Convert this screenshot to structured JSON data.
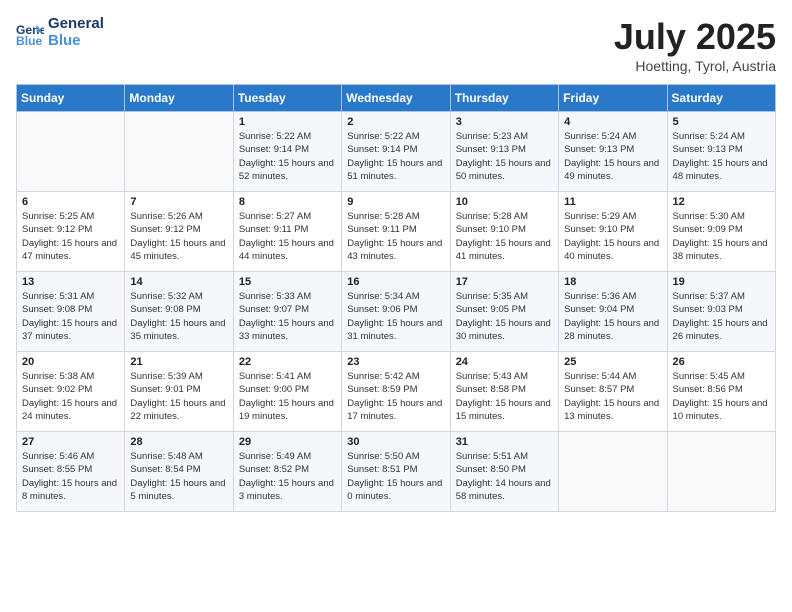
{
  "header": {
    "logo_line1": "General",
    "logo_line2": "Blue",
    "title": "July 2025",
    "subtitle": "Hoetting, Tyrol, Austria"
  },
  "weekdays": [
    "Sunday",
    "Monday",
    "Tuesday",
    "Wednesday",
    "Thursday",
    "Friday",
    "Saturday"
  ],
  "weeks": [
    [
      {
        "day": "",
        "sunrise": "",
        "sunset": "",
        "daylight": ""
      },
      {
        "day": "",
        "sunrise": "",
        "sunset": "",
        "daylight": ""
      },
      {
        "day": "1",
        "sunrise": "Sunrise: 5:22 AM",
        "sunset": "Sunset: 9:14 PM",
        "daylight": "Daylight: 15 hours and 52 minutes."
      },
      {
        "day": "2",
        "sunrise": "Sunrise: 5:22 AM",
        "sunset": "Sunset: 9:14 PM",
        "daylight": "Daylight: 15 hours and 51 minutes."
      },
      {
        "day": "3",
        "sunrise": "Sunrise: 5:23 AM",
        "sunset": "Sunset: 9:13 PM",
        "daylight": "Daylight: 15 hours and 50 minutes."
      },
      {
        "day": "4",
        "sunrise": "Sunrise: 5:24 AM",
        "sunset": "Sunset: 9:13 PM",
        "daylight": "Daylight: 15 hours and 49 minutes."
      },
      {
        "day": "5",
        "sunrise": "Sunrise: 5:24 AM",
        "sunset": "Sunset: 9:13 PM",
        "daylight": "Daylight: 15 hours and 48 minutes."
      }
    ],
    [
      {
        "day": "6",
        "sunrise": "Sunrise: 5:25 AM",
        "sunset": "Sunset: 9:12 PM",
        "daylight": "Daylight: 15 hours and 47 minutes."
      },
      {
        "day": "7",
        "sunrise": "Sunrise: 5:26 AM",
        "sunset": "Sunset: 9:12 PM",
        "daylight": "Daylight: 15 hours and 45 minutes."
      },
      {
        "day": "8",
        "sunrise": "Sunrise: 5:27 AM",
        "sunset": "Sunset: 9:11 PM",
        "daylight": "Daylight: 15 hours and 44 minutes."
      },
      {
        "day": "9",
        "sunrise": "Sunrise: 5:28 AM",
        "sunset": "Sunset: 9:11 PM",
        "daylight": "Daylight: 15 hours and 43 minutes."
      },
      {
        "day": "10",
        "sunrise": "Sunrise: 5:28 AM",
        "sunset": "Sunset: 9:10 PM",
        "daylight": "Daylight: 15 hours and 41 minutes."
      },
      {
        "day": "11",
        "sunrise": "Sunrise: 5:29 AM",
        "sunset": "Sunset: 9:10 PM",
        "daylight": "Daylight: 15 hours and 40 minutes."
      },
      {
        "day": "12",
        "sunrise": "Sunrise: 5:30 AM",
        "sunset": "Sunset: 9:09 PM",
        "daylight": "Daylight: 15 hours and 38 minutes."
      }
    ],
    [
      {
        "day": "13",
        "sunrise": "Sunrise: 5:31 AM",
        "sunset": "Sunset: 9:08 PM",
        "daylight": "Daylight: 15 hours and 37 minutes."
      },
      {
        "day": "14",
        "sunrise": "Sunrise: 5:32 AM",
        "sunset": "Sunset: 9:08 PM",
        "daylight": "Daylight: 15 hours and 35 minutes."
      },
      {
        "day": "15",
        "sunrise": "Sunrise: 5:33 AM",
        "sunset": "Sunset: 9:07 PM",
        "daylight": "Daylight: 15 hours and 33 minutes."
      },
      {
        "day": "16",
        "sunrise": "Sunrise: 5:34 AM",
        "sunset": "Sunset: 9:06 PM",
        "daylight": "Daylight: 15 hours and 31 minutes."
      },
      {
        "day": "17",
        "sunrise": "Sunrise: 5:35 AM",
        "sunset": "Sunset: 9:05 PM",
        "daylight": "Daylight: 15 hours and 30 minutes."
      },
      {
        "day": "18",
        "sunrise": "Sunrise: 5:36 AM",
        "sunset": "Sunset: 9:04 PM",
        "daylight": "Daylight: 15 hours and 28 minutes."
      },
      {
        "day": "19",
        "sunrise": "Sunrise: 5:37 AM",
        "sunset": "Sunset: 9:03 PM",
        "daylight": "Daylight: 15 hours and 26 minutes."
      }
    ],
    [
      {
        "day": "20",
        "sunrise": "Sunrise: 5:38 AM",
        "sunset": "Sunset: 9:02 PM",
        "daylight": "Daylight: 15 hours and 24 minutes."
      },
      {
        "day": "21",
        "sunrise": "Sunrise: 5:39 AM",
        "sunset": "Sunset: 9:01 PM",
        "daylight": "Daylight: 15 hours and 22 minutes."
      },
      {
        "day": "22",
        "sunrise": "Sunrise: 5:41 AM",
        "sunset": "Sunset: 9:00 PM",
        "daylight": "Daylight: 15 hours and 19 minutes."
      },
      {
        "day": "23",
        "sunrise": "Sunrise: 5:42 AM",
        "sunset": "Sunset: 8:59 PM",
        "daylight": "Daylight: 15 hours and 17 minutes."
      },
      {
        "day": "24",
        "sunrise": "Sunrise: 5:43 AM",
        "sunset": "Sunset: 8:58 PM",
        "daylight": "Daylight: 15 hours and 15 minutes."
      },
      {
        "day": "25",
        "sunrise": "Sunrise: 5:44 AM",
        "sunset": "Sunset: 8:57 PM",
        "daylight": "Daylight: 15 hours and 13 minutes."
      },
      {
        "day": "26",
        "sunrise": "Sunrise: 5:45 AM",
        "sunset": "Sunset: 8:56 PM",
        "daylight": "Daylight: 15 hours and 10 minutes."
      }
    ],
    [
      {
        "day": "27",
        "sunrise": "Sunrise: 5:46 AM",
        "sunset": "Sunset: 8:55 PM",
        "daylight": "Daylight: 15 hours and 8 minutes."
      },
      {
        "day": "28",
        "sunrise": "Sunrise: 5:48 AM",
        "sunset": "Sunset: 8:54 PM",
        "daylight": "Daylight: 15 hours and 5 minutes."
      },
      {
        "day": "29",
        "sunrise": "Sunrise: 5:49 AM",
        "sunset": "Sunset: 8:52 PM",
        "daylight": "Daylight: 15 hours and 3 minutes."
      },
      {
        "day": "30",
        "sunrise": "Sunrise: 5:50 AM",
        "sunset": "Sunset: 8:51 PM",
        "daylight": "Daylight: 15 hours and 0 minutes."
      },
      {
        "day": "31",
        "sunrise": "Sunrise: 5:51 AM",
        "sunset": "Sunset: 8:50 PM",
        "daylight": "Daylight: 14 hours and 58 minutes."
      },
      {
        "day": "",
        "sunrise": "",
        "sunset": "",
        "daylight": ""
      },
      {
        "day": "",
        "sunrise": "",
        "sunset": "",
        "daylight": ""
      }
    ]
  ]
}
